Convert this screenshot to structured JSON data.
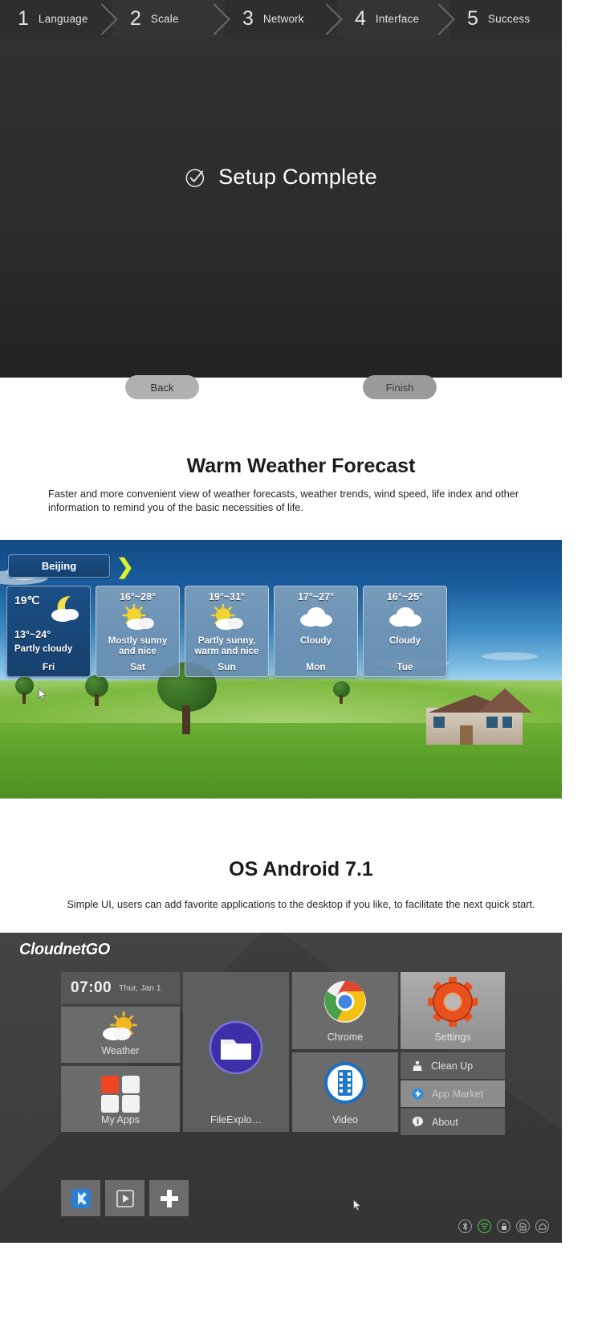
{
  "wizard": {
    "steps": [
      {
        "num": "1",
        "label": "Language"
      },
      {
        "num": "2",
        "label": "Scale"
      },
      {
        "num": "3",
        "label": "Network"
      },
      {
        "num": "4",
        "label": "Interface"
      },
      {
        "num": "5",
        "label": "Success"
      }
    ],
    "status_text": "Setup Complete",
    "status_icon": "check-circle-icon",
    "back_label": "Back",
    "finish_label": "Finish"
  },
  "weather_section": {
    "title": "Warm Weather Forecast",
    "description": "Faster and more convenient view of weather forecasts, weather trends, wind speed, life index and other information to remind you of the basic necessities of life.",
    "city": "Beijing",
    "arrow_icon": "chevron-right-icon",
    "cards": [
      {
        "current": "19℃",
        "range": "13°~24°",
        "cond": "Partly cloudy",
        "day": "Fri",
        "icon": "moon-cloud-icon"
      },
      {
        "current": "",
        "range": "16°~28°",
        "cond": "Mostly sunny and nice",
        "day": "Sat",
        "icon": "sun-cloud-icon"
      },
      {
        "current": "",
        "range": "19°~31°",
        "cond": "Partly sunny, warm and nice",
        "day": "Sun",
        "icon": "sun-cloud-icon"
      },
      {
        "current": "",
        "range": "17°~27°",
        "cond": "Cloudy",
        "day": "Mon",
        "icon": "cloud-icon"
      },
      {
        "current": "",
        "range": "16°~25°",
        "cond": "Cloudy",
        "day": "Tue",
        "icon": "cloud-icon"
      }
    ]
  },
  "os_section": {
    "title": "OS Android 7.1",
    "description": "Simple UI, users can add favorite applications to the desktop if you like, to facilitate the next quick start."
  },
  "desktop": {
    "brand": "CloudnetGO",
    "clock": {
      "time": "07:00",
      "date": "Thur, Jan 1"
    },
    "tiles": [
      {
        "label": "Weather",
        "icon": "sun-cloud-icon"
      },
      {
        "label": "My Apps",
        "icon": "apps-grid-icon"
      },
      {
        "label": "FileExplo…",
        "icon": "folder-icon"
      },
      {
        "label": "Chrome",
        "icon": "chrome-icon"
      },
      {
        "label": "Video",
        "icon": "film-icon"
      },
      {
        "label": "Settings",
        "icon": "gear-icon"
      }
    ],
    "menu": [
      {
        "label": "Clean Up",
        "icon": "broom-icon",
        "highlighted": false
      },
      {
        "label": "App Market",
        "icon": "app-market-icon",
        "highlighted": true
      },
      {
        "label": "About",
        "icon": "info-icon",
        "highlighted": false
      }
    ],
    "dock": [
      {
        "icon": "kodi-icon"
      },
      {
        "icon": "play-store-icon"
      },
      {
        "icon": "plus-icon"
      }
    ],
    "status_icons": [
      "bluetooth-icon",
      "wifi-icon",
      "lock-icon",
      "sd-card-icon",
      "home-icon"
    ]
  },
  "colors": {
    "wizard_bg": "#2b2b2b",
    "accent_yellow": "#ddf22a",
    "sky_blue": "#1a5d9e",
    "grass_green": "#63a82f",
    "desktop_bg": "#3a3a3a",
    "settings_orange": "#e8501e"
  }
}
